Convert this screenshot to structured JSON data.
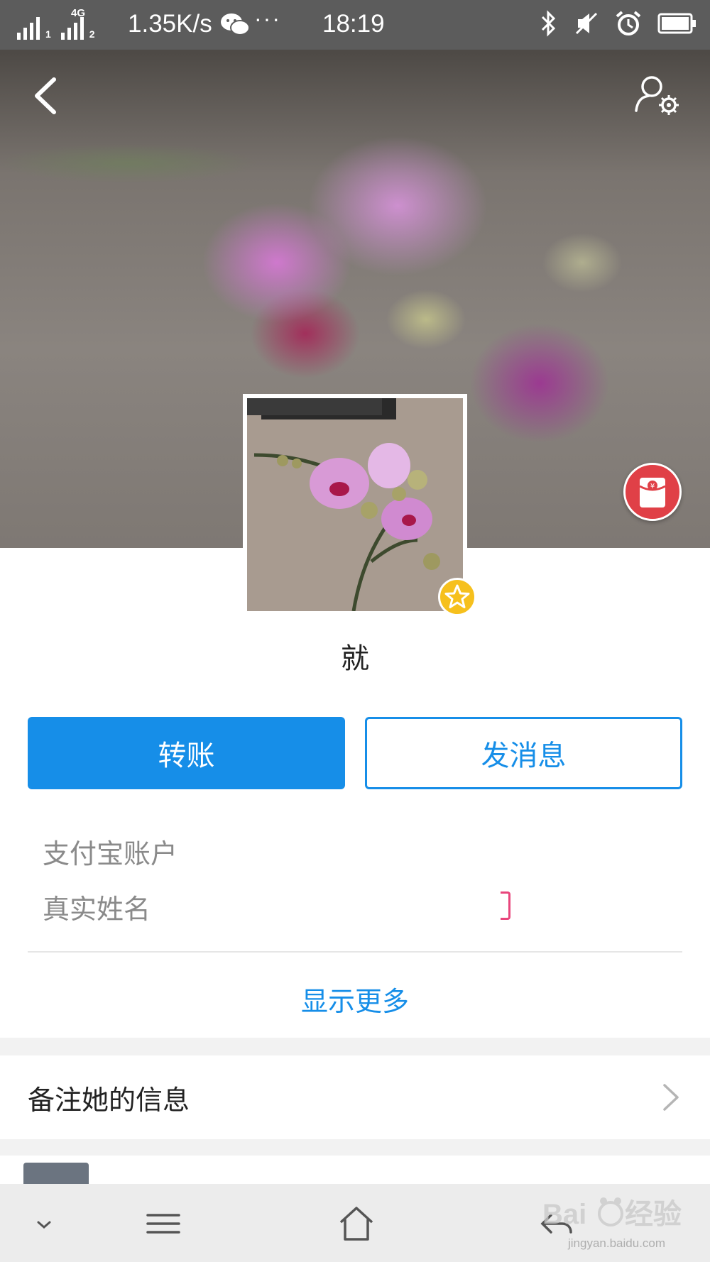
{
  "status_bar": {
    "network_type": "4G",
    "sim1": "1",
    "sim2": "2",
    "net_speed": "1.35K/s",
    "more": "···",
    "time": "18:19",
    "icons": [
      "signal-icon",
      "wechat-icon",
      "bluetooth-icon",
      "mute-icon",
      "alarm-icon",
      "battery-icon"
    ]
  },
  "header": {
    "back_icon": "chevron-left-icon",
    "settings_icon": "user-settings-icon",
    "red_packet_icon": "red-packet-icon"
  },
  "profile": {
    "name": "就",
    "badge_icon": "star-icon"
  },
  "actions": {
    "transfer_label": "转账",
    "message_label": "发消息"
  },
  "info": {
    "account_label": "支付宝账户",
    "real_name_label": "真实姓名",
    "show_more": "显示更多"
  },
  "remark": {
    "label": "备注她的信息"
  },
  "navbar": {
    "icons": [
      "chevron-down-icon",
      "menu-icon",
      "home-icon",
      "back-icon"
    ]
  },
  "watermark": {
    "text": "jingyan.baidu.com"
  },
  "colors": {
    "accent": "#168ee8",
    "red_packet": "#e04047",
    "star": "#f6c01d",
    "status_bar": "#5c5c5c"
  }
}
